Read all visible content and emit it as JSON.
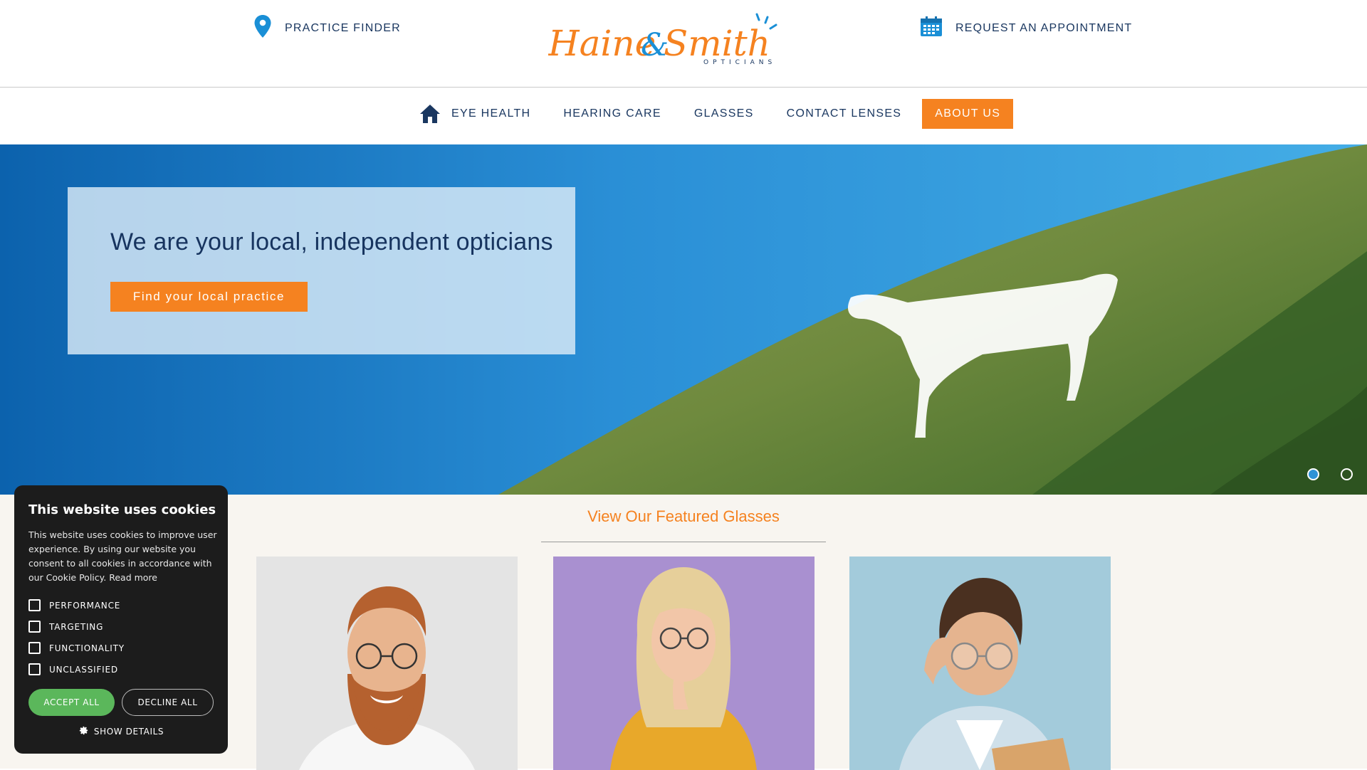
{
  "header": {
    "practice_finder": "PRACTICE FINDER",
    "request_appointment": "REQUEST AN APPOINTMENT",
    "logo_text": "Haine & Smith",
    "logo_sub": "OPTICIANS"
  },
  "nav": {
    "items": [
      {
        "label": "EYE HEALTH"
      },
      {
        "label": "HEARING CARE"
      },
      {
        "label": "GLASSES"
      },
      {
        "label": "CONTACT LENSES"
      },
      {
        "label": "ABOUT US"
      }
    ],
    "active_index": 4
  },
  "hero": {
    "title": "We are your local, independent opticians",
    "button": "Find your local practice",
    "slides": 2,
    "active_slide": 1
  },
  "featured": {
    "title": "View Our Featured Glasses"
  },
  "cookie": {
    "title": "This website uses cookies",
    "text": "This website uses cookies to improve user experience. By using our website you consent to all cookies in accordance with our Cookie Policy.",
    "read_more": "Read more",
    "options": [
      "PERFORMANCE",
      "TARGETING",
      "FUNCTIONALITY",
      "UNCLASSIFIED"
    ],
    "accept": "ACCEPT ALL",
    "decline": "DECLINE ALL",
    "show_details": "SHOW DETAILS"
  },
  "colors": {
    "brand_orange": "#f58220",
    "brand_navy": "#1a3760",
    "brand_blue": "#0f8fd6",
    "accept_green": "#5bb75b"
  },
  "icons": [
    "map-pin-icon",
    "calendar-icon",
    "home-icon",
    "gear-icon"
  ]
}
